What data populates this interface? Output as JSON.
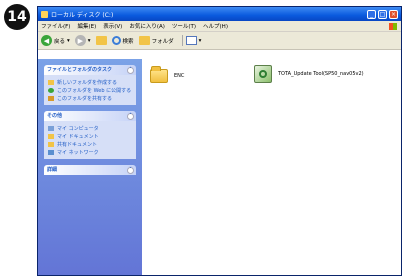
{
  "step_badge": "14",
  "window": {
    "title": "ローカル ディスク (C:)",
    "controls": [
      "_",
      "□",
      "×"
    ]
  },
  "menubar": [
    "ファイル(F)",
    "編集(E)",
    "表示(V)",
    "お気に入り(A)",
    "ツール(T)",
    "ヘルプ(H)"
  ],
  "toolbar": {
    "back_label": "戻る",
    "search_label": "検索",
    "folders_label": "フォルダ"
  },
  "left_pane": {
    "tasks": {
      "header": "ファイルとフォルダのタスク",
      "items": [
        "新しいフォルダを作成する",
        "このフォルダを Web に公開する",
        "このフォルダを共有する"
      ]
    },
    "places": {
      "header": "その他",
      "items": [
        "マイ コンピュータ",
        "マイ ドキュメント",
        "共有ドキュメント",
        "マイ ネットワーク"
      ]
    },
    "details": {
      "header": "詳細"
    }
  },
  "files": [
    {
      "name": "ENC",
      "icon": "folder-icon"
    },
    {
      "name": "TOTA_Update Tool(SP50_nav05v2)",
      "icon": "installer-icon"
    }
  ],
  "colors": {
    "title_bar": "#0a5ade",
    "left_pane": "#7ba2e7",
    "task_link": "#215dc6"
  }
}
